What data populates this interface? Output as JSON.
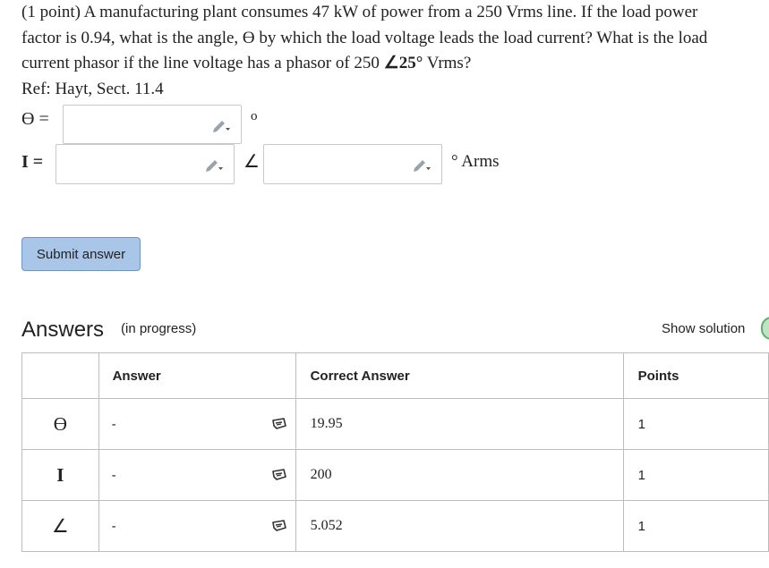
{
  "problem": {
    "line1": "(1 point) A manufacturing plant consumes 47 kW of power from a 250 Vrms line. If the load power",
    "line2": "factor is 0.94, what is the angle, ϴ by which the load voltage leads the load current? What is the load",
    "line3_a": "current phasor if the line voltage has a phasor of 250 ",
    "line3_angle": "∠25°",
    "line3_b": " Vrms?",
    "ref": "Ref: Hayt, Sect. 11.4"
  },
  "inputs": {
    "theta_label": "ϴ =",
    "theta_value": "",
    "theta_unit": "o",
    "current_label": "I =",
    "current_mag_value": "",
    "angle_symbol": "∠",
    "current_angle_value": "",
    "current_unit": "° Arms"
  },
  "submit_label": "Submit answer",
  "answers": {
    "title": "Answers",
    "status": "(in progress)",
    "show_solution": "Show solution",
    "headers": {
      "answer": "Answer",
      "correct": "Correct Answer",
      "points": "Points"
    },
    "rows": [
      {
        "symbol": "ϴ",
        "answer": "-",
        "correct": "19.95",
        "points": "1"
      },
      {
        "symbol": "I",
        "answer": "-",
        "correct": "200",
        "points": "1"
      },
      {
        "symbol": "∠",
        "answer": "-",
        "correct": "5.052",
        "points": "1"
      }
    ]
  },
  "colors": {
    "button_bg": "#a9c6e8",
    "button_border": "#6f95c4",
    "toggle": "#bfe3c3"
  }
}
